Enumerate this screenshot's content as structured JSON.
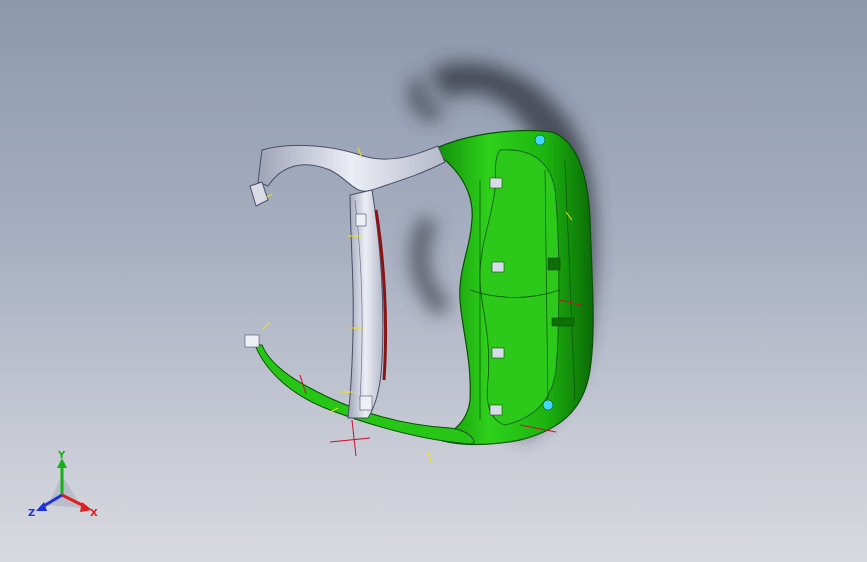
{
  "viewport": {
    "background_top": "#8d98ad",
    "background_bottom": "#d8d9e0"
  },
  "model": {
    "part_color_primary": "#22c414",
    "part_color_dark": "#0e6e08",
    "frame_color": "#d9dbe6",
    "shadow_color": "#2f323a",
    "accent_red": "#c8102e",
    "accent_yellow": "#f2e600",
    "clip_cyan": "#3fd8ff"
  },
  "triad": {
    "x_label": "X",
    "y_label": "Y",
    "z_label": "Z",
    "x_color": "#e02020",
    "y_color": "#18b018",
    "z_color": "#2030e0"
  }
}
